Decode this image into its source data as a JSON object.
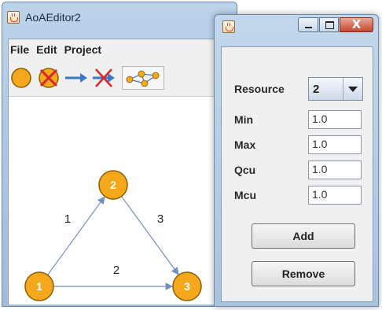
{
  "main_window": {
    "title": "AoAEditor2",
    "menu": [
      "File",
      "Edit",
      "Project"
    ],
    "toolbar": [
      {
        "name": "add-node-tool",
        "icon": "orange-circle-icon"
      },
      {
        "name": "delete-node-tool",
        "icon": "crossed-circle-icon"
      },
      {
        "name": "add-edge-tool",
        "icon": "arrow-right-icon"
      },
      {
        "name": "delete-edge-tool",
        "icon": "crossed-arrow-icon"
      },
      {
        "name": "auto-layout-tool",
        "icon": "graph-layout-icon"
      }
    ]
  },
  "graph": {
    "colors": {
      "node_fill": "#f5a81c",
      "node_border": "#8a6000",
      "edge": "#7090c0",
      "label": "#ffffff"
    },
    "nodes": [
      {
        "id": "1",
        "label": "1"
      },
      {
        "id": "2",
        "label": "2"
      },
      {
        "id": "3",
        "label": "3"
      }
    ],
    "edges": [
      {
        "from": "1",
        "to": "2",
        "label": "1"
      },
      {
        "from": "2",
        "to": "3",
        "label": "3"
      },
      {
        "from": "1",
        "to": "3",
        "label": "2"
      }
    ]
  },
  "dialog": {
    "title": "",
    "close_label": "X",
    "resource": {
      "label": "Resource",
      "value": "2"
    },
    "fields": [
      {
        "label": "Min",
        "value": "1.0"
      },
      {
        "label": "Max",
        "value": "1.0"
      },
      {
        "label": "Qcu",
        "value": "1.0"
      },
      {
        "label": "Mcu",
        "value": "1.0"
      }
    ],
    "buttons": {
      "add": "Add",
      "remove": "Remove"
    }
  }
}
